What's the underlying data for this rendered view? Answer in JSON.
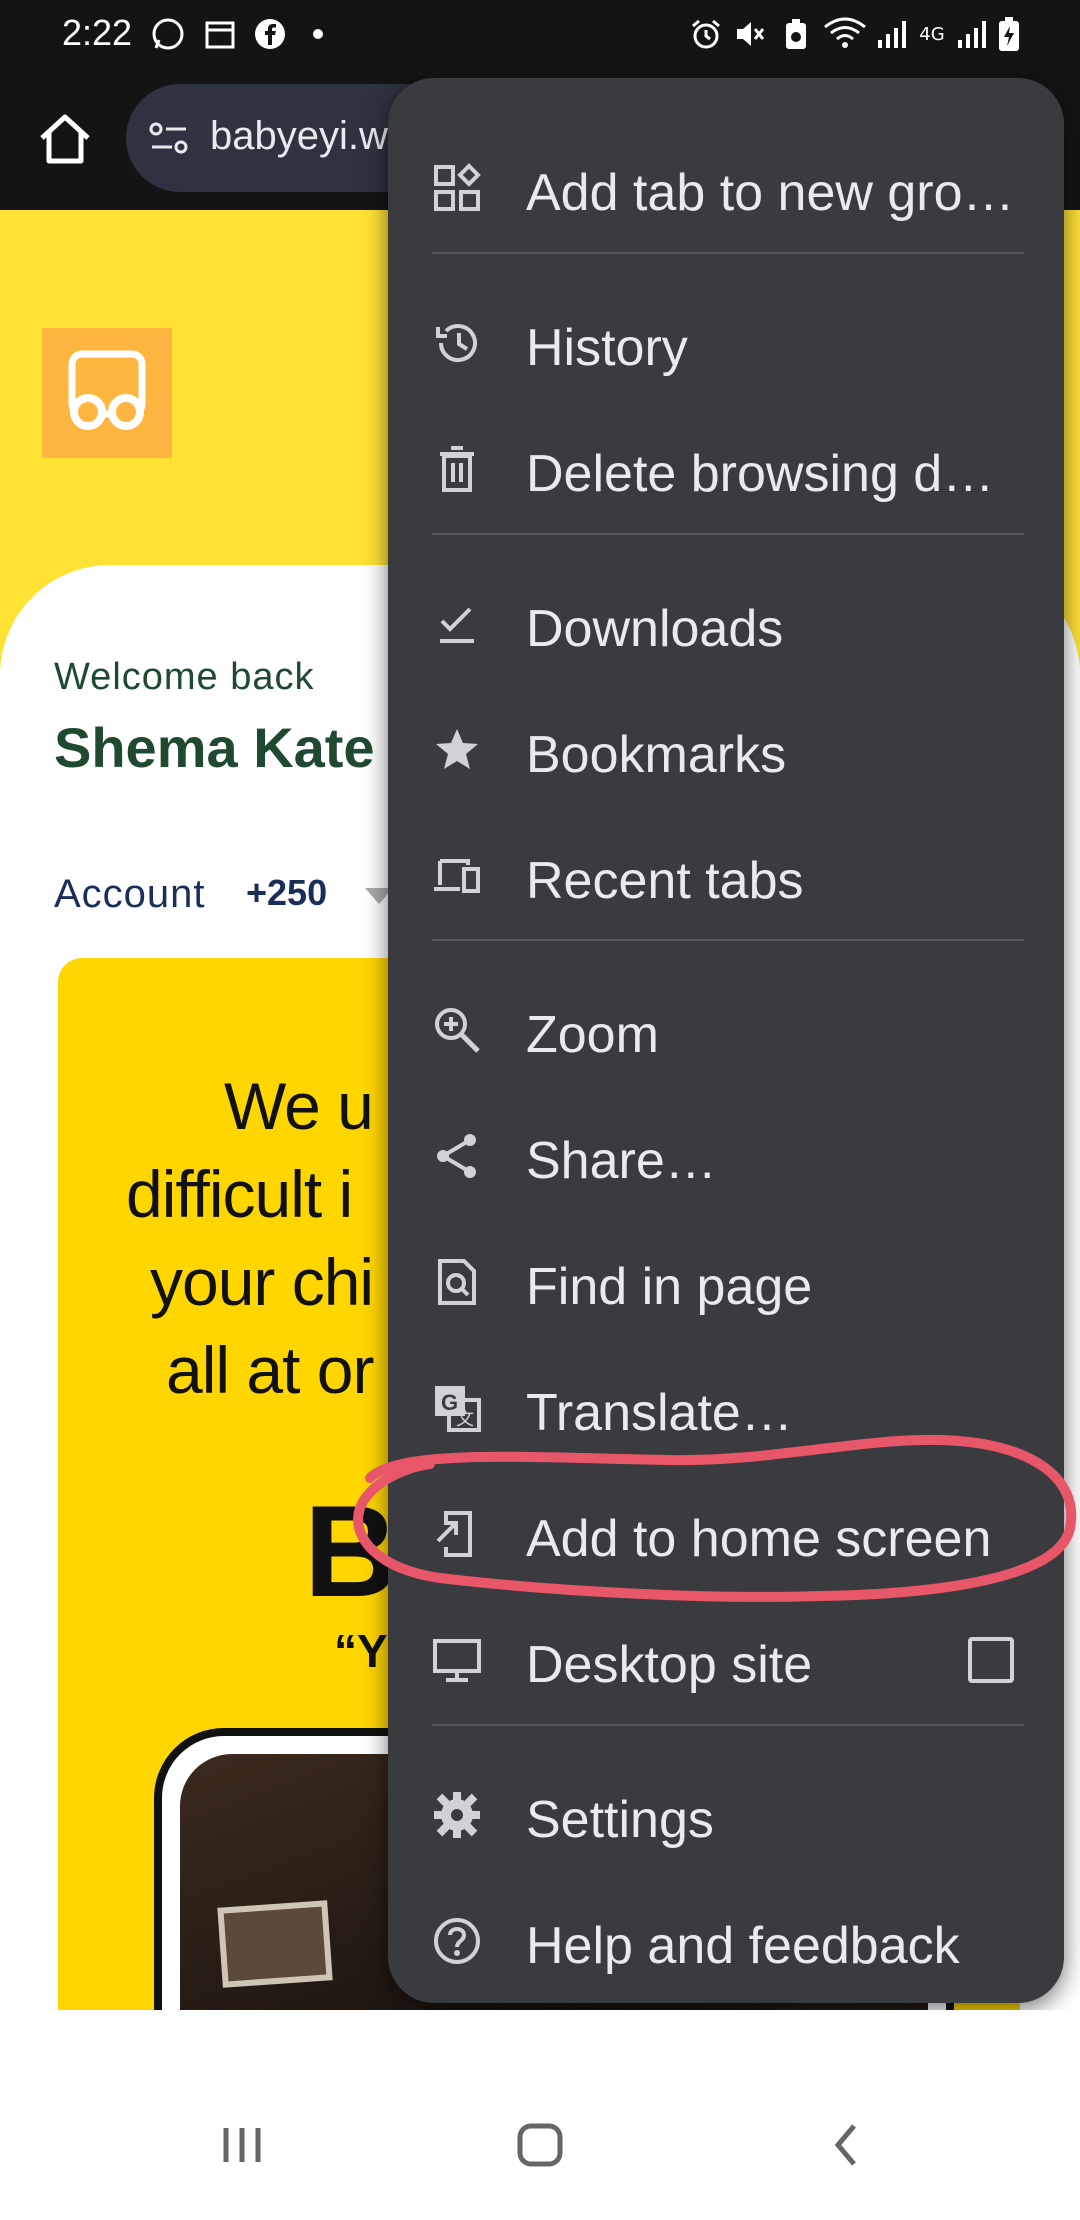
{
  "status_bar": {
    "time": "2:22",
    "icons": [
      "whatsapp-icon",
      "calendar-icon",
      "facebook-icon",
      "dot-icon",
      "alarm-icon",
      "mute-icon",
      "battery-saver-icon",
      "wifi-icon",
      "signal-icon",
      "network-4g-icon",
      "signal-icon-2",
      "battery-charging-icon"
    ],
    "network_label": "4G"
  },
  "toolbar": {
    "url": "babyeyi.w"
  },
  "page": {
    "welcome": "Welcome back",
    "user_name": "Shema Kate",
    "account_label": "Account",
    "account_code": "+250",
    "promo_lines": [
      "We u",
      "difficult i",
      "your chi",
      "all at or"
    ],
    "promo_big": "B",
    "promo_quote": "“Y"
  },
  "menu": {
    "items": [
      {
        "label": "Add tab to new gro…",
        "icon": "add-to-group-icon"
      },
      {
        "label": "History",
        "icon": "history-icon"
      },
      {
        "label": "Delete browsing d…",
        "icon": "delete-icon"
      },
      {
        "label": "Downloads",
        "icon": "download-icon"
      },
      {
        "label": "Bookmarks",
        "icon": "star-icon"
      },
      {
        "label": "Recent tabs",
        "icon": "devices-icon"
      },
      {
        "label": "Zoom",
        "icon": "zoom-icon"
      },
      {
        "label": "Share…",
        "icon": "share-icon"
      },
      {
        "label": "Find in page",
        "icon": "find-in-page-icon"
      },
      {
        "label": "Translate…",
        "icon": "translate-icon"
      },
      {
        "label": "Add to home screen",
        "icon": "add-to-home-icon"
      },
      {
        "label": "Desktop site",
        "icon": "desktop-icon",
        "checked": false
      },
      {
        "label": "Settings",
        "icon": "settings-icon"
      },
      {
        "label": "Help and feedback",
        "icon": "help-icon"
      }
    ]
  },
  "annotation": {
    "highlighted_item": "Add to home screen",
    "color": "#e8566a"
  },
  "colors": {
    "menu_bg": "#3a3b3f",
    "page_yellow": "#ffe234",
    "promo_yellow": "#ffd600",
    "logo_orange": "#ffb640"
  }
}
